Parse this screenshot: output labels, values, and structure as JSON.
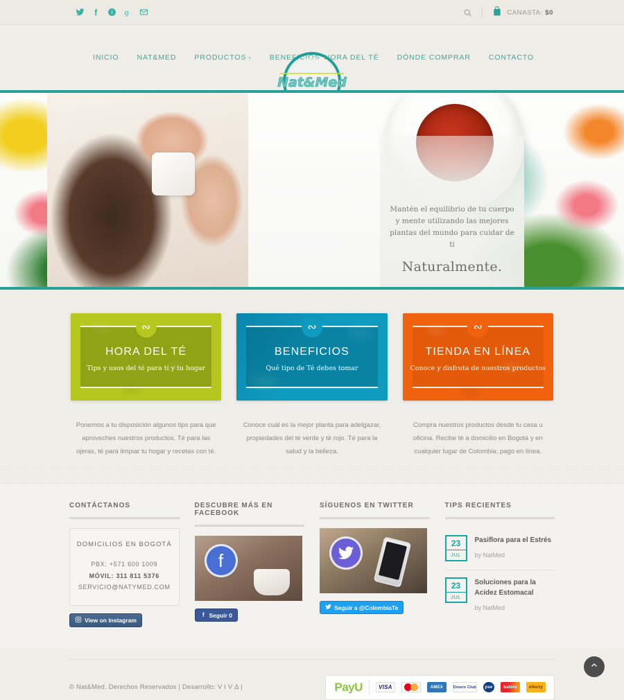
{
  "topbar": {
    "social_icons": [
      {
        "name": "twitter-icon",
        "label": "Twitter"
      },
      {
        "name": "facebook-icon",
        "label": "Facebook"
      },
      {
        "name": "pinterest-icon",
        "label": "Pinterest"
      },
      {
        "name": "google-plus-icon",
        "label": "Google Plus"
      },
      {
        "name": "email-icon",
        "label": "Email"
      }
    ],
    "search_icon": "search-icon",
    "cart_icon": "shopping-bag-icon",
    "cart_label": "CANASTA:",
    "cart_total": "$0"
  },
  "header": {
    "logo_text": "Nat&Med",
    "nav_left": [
      {
        "label": "INICIO",
        "has_caret": false
      },
      {
        "label": "NAT&MED",
        "has_caret": false
      },
      {
        "label": "PRODUCTOS",
        "has_caret": true
      },
      {
        "label": "BENEFICIOS",
        "has_caret": false
      }
    ],
    "nav_right": [
      {
        "label": "HORA DEL TÉ"
      },
      {
        "label": "DÓNDE COMPRAR"
      },
      {
        "label": "CONTACTO"
      }
    ]
  },
  "hero": {
    "quote_top": "Mantén el equilibrio de tu cuerpo y mente utilizando las mejores plantas del mundo para cuidar de ti",
    "quote_big": "Naturalmente."
  },
  "cards": [
    {
      "title": "HORA DEL TÉ",
      "subtitle": "Tips y usos del té para ti y tu hogar",
      "description": "Ponemos a tu disposición algunos tips para que aproveches nuestros productos. Té para las ojeras, té para limpiar tu hogar y recetas con té.",
      "color": "#b6c820"
    },
    {
      "title": "BENEFICIOS",
      "subtitle": "Qué tipo de Té debes tomar",
      "description": "Conoce cuál es la mejor planta para adelgazar, propiedades del té verde y té rojo. Té para la salud y la belleza.",
      "color": "#0f9bbf"
    },
    {
      "title": "TIENDA EN LÍNEA",
      "subtitle": "Conoce y disfruta de nuestros productos",
      "description": "Compra nuestros productos desde tu casa u oficina. Recibe té a domicilio en Bogotá y en cualquier lugar de Colombia; pago en línea.",
      "color": "#f0620e"
    }
  ],
  "widgets": {
    "contact": {
      "title": "CONTÁCTANOS",
      "box_title": "DOMICILIOS EN BOGOTÁ",
      "pbx": "PBX: +571 600 1009",
      "mobile": "MÓVIL: 311 811 5376",
      "email": "SERVICIO@NATYMED.COM",
      "instagram_button": "View on Instagram",
      "instagram_icon": "instagram-icon"
    },
    "facebook": {
      "title": "DESCUBRE MÁS EN FACEBOOK",
      "follow_button": "Seguir 0",
      "icon": "facebook-icon"
    },
    "twitter": {
      "title": "SÍGUENOS EN TWITTER",
      "follow_button": "Seguir a @ColombiaTe",
      "icon": "twitter-icon"
    },
    "tips": {
      "title": "TIPS RECIENTES",
      "items": [
        {
          "day": "23",
          "month": "JUL",
          "title": "Pasiflora para el Estrés",
          "by": "by NatMed"
        },
        {
          "day": "23",
          "month": "JUL",
          "title": "Soluciones para la Acidez Estomacal",
          "by": "by NatMed"
        }
      ]
    }
  },
  "footer": {
    "copyright": "© Nat&Med. Derechos Reservados | Desarrollo: V I V Δ |",
    "payu_logo": "PayU",
    "payment_methods": [
      {
        "name": "visa",
        "label": "VISA"
      },
      {
        "name": "mastercard",
        "label": ""
      },
      {
        "name": "amex",
        "label": "AMEX"
      },
      {
        "name": "diners-club",
        "label": "Diners Club"
      },
      {
        "name": "pse",
        "label": "pse"
      },
      {
        "name": "baloto",
        "label": "baloto"
      },
      {
        "name": "efecty",
        "label": "efecty"
      }
    ],
    "back_to_top_icon": "chevron-up-icon"
  }
}
